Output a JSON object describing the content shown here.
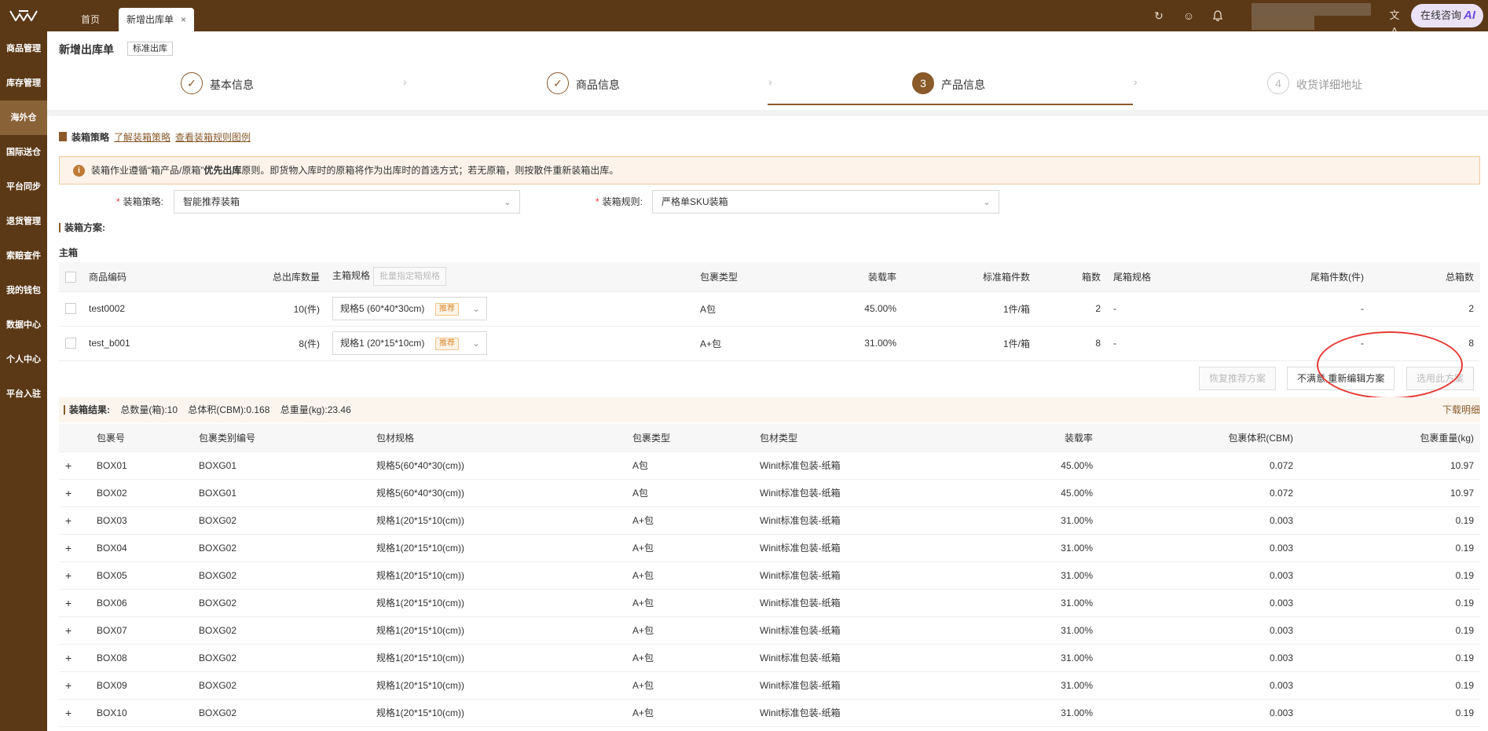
{
  "topbar": {
    "tabs": [
      {
        "label": "首页"
      },
      {
        "label": "新增出库单",
        "close": "×"
      }
    ],
    "consult": "在线咨询",
    "ai": "AI"
  },
  "sidebar": {
    "items": [
      {
        "label": "商品管理"
      },
      {
        "label": "库存管理"
      },
      {
        "label": "海外仓"
      },
      {
        "label": "国际送仓"
      },
      {
        "label": "平台同步"
      },
      {
        "label": "退货管理"
      },
      {
        "label": "索赔查件"
      },
      {
        "label": "我的钱包"
      },
      {
        "label": "数据中心"
      },
      {
        "label": "个人中心"
      },
      {
        "label": "平台入驻"
      }
    ]
  },
  "header": {
    "title": "新增出库单",
    "badge": "标准出库"
  },
  "steps": [
    {
      "num": "✓",
      "label": "基本信息"
    },
    {
      "num": "✓",
      "label": "商品信息"
    },
    {
      "num": "3",
      "label": "产品信息"
    },
    {
      "num": "4",
      "label": "收货详细地址"
    }
  ],
  "strategy": {
    "title": "装箱策略",
    "link1": "了解装箱策略",
    "link2": "查看装箱规则图例",
    "alert_pre": "装箱作业遵循“箱产品/原箱”",
    "alert_bold": "优先出库",
    "alert_post": "原则。即货物入库时的原箱将作为出库时的首选方式；若无原箱，则按散件重新装箱出库。",
    "f1_label": "装箱策略:",
    "f1_value": "智能推荐装箱",
    "f2_label": "装箱规则:",
    "f2_value": "严格单SKU装箱",
    "req": "*"
  },
  "plan": {
    "title": "装箱方案:",
    "main": "主箱",
    "headers": {
      "code": "商品编码",
      "qty": "总出库数量",
      "spec": "主箱规格",
      "batch": "批量指定箱规格",
      "pkg": "包裹类型",
      "rate": "装载率",
      "std": "标准箱件数",
      "boxes": "箱数",
      "tail": "尾箱规格",
      "tailqty": "尾箱件数(件)",
      "total": "总箱数"
    },
    "rows": [
      {
        "code": "test0002",
        "qty": "10(件)",
        "spec": "规格5 (60*40*30cm)",
        "rec": "推荐",
        "pkg": "A包",
        "rate": "45.00%",
        "std": "1件/箱",
        "boxes": "2",
        "tail": "-",
        "tailqty": "-",
        "total": "2"
      },
      {
        "code": "test_b001",
        "qty": "8(件)",
        "spec": "规格1 (20*15*10cm)",
        "rec": "推荐",
        "pkg": "A+包",
        "rate": "31.00%",
        "std": "1件/箱",
        "boxes": "8",
        "tail": "-",
        "tailqty": "-",
        "total": "8"
      }
    ],
    "btn_restore": "恢复推荐方案",
    "btn_reedit": "不满意,重新编辑方案",
    "btn_use": "选用此方案"
  },
  "result": {
    "title": "装箱结果:",
    "total_qty": "总数量(箱):10",
    "total_vol": "总体积(CBM):0.168",
    "total_wt": "总重量(kg):23.46",
    "download": "下载明细",
    "headers": {
      "box": "包裹号",
      "cat": "包裹类别编号",
      "spec": "包材规格",
      "pkg": "包裹类型",
      "mat": "包材类型",
      "rate": "装载率",
      "vol": "包裹体积(CBM)",
      "wt": "包裹重量(kg)"
    },
    "rows": [
      {
        "box": "BOX01",
        "cat": "BOXG01",
        "spec": "规格5(60*40*30(cm))",
        "pkg": "A包",
        "mat": "Winit标准包装-纸箱",
        "rate": "45.00%",
        "vol": "0.072",
        "wt": "10.97"
      },
      {
        "box": "BOX02",
        "cat": "BOXG01",
        "spec": "规格5(60*40*30(cm))",
        "pkg": "A包",
        "mat": "Winit标准包装-纸箱",
        "rate": "45.00%",
        "vol": "0.072",
        "wt": "10.97"
      },
      {
        "box": "BOX03",
        "cat": "BOXG02",
        "spec": "规格1(20*15*10(cm))",
        "pkg": "A+包",
        "mat": "Winit标准包装-纸箱",
        "rate": "31.00%",
        "vol": "0.003",
        "wt": "0.19"
      },
      {
        "box": "BOX04",
        "cat": "BOXG02",
        "spec": "规格1(20*15*10(cm))",
        "pkg": "A+包",
        "mat": "Winit标准包装-纸箱",
        "rate": "31.00%",
        "vol": "0.003",
        "wt": "0.19"
      },
      {
        "box": "BOX05",
        "cat": "BOXG02",
        "spec": "规格1(20*15*10(cm))",
        "pkg": "A+包",
        "mat": "Winit标准包装-纸箱",
        "rate": "31.00%",
        "vol": "0.003",
        "wt": "0.19"
      },
      {
        "box": "BOX06",
        "cat": "BOXG02",
        "spec": "规格1(20*15*10(cm))",
        "pkg": "A+包",
        "mat": "Winit标准包装-纸箱",
        "rate": "31.00%",
        "vol": "0.003",
        "wt": "0.19"
      },
      {
        "box": "BOX07",
        "cat": "BOXG02",
        "spec": "规格1(20*15*10(cm))",
        "pkg": "A+包",
        "mat": "Winit标准包装-纸箱",
        "rate": "31.00%",
        "vol": "0.003",
        "wt": "0.19"
      },
      {
        "box": "BOX08",
        "cat": "BOXG02",
        "spec": "规格1(20*15*10(cm))",
        "pkg": "A+包",
        "mat": "Winit标准包装-纸箱",
        "rate": "31.00%",
        "vol": "0.003",
        "wt": "0.19"
      },
      {
        "box": "BOX09",
        "cat": "BOXG02",
        "spec": "规格1(20*15*10(cm))",
        "pkg": "A+包",
        "mat": "Winit标准包装-纸箱",
        "rate": "31.00%",
        "vol": "0.003",
        "wt": "0.19"
      },
      {
        "box": "BOX10",
        "cat": "BOXG02",
        "spec": "规格1(20*15*10(cm))",
        "pkg": "A+包",
        "mat": "Winit标准包装-纸箱",
        "rate": "31.00%",
        "vol": "0.003",
        "wt": "0.19"
      }
    ]
  }
}
